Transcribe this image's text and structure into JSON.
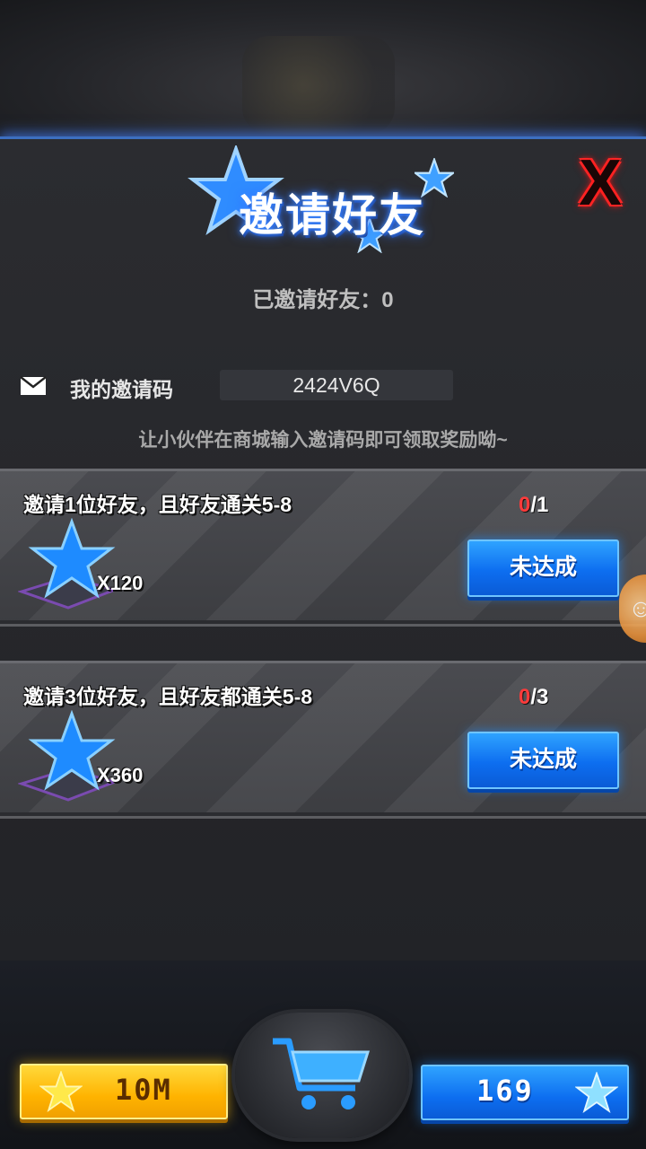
{
  "header": {
    "title": "邀请好友",
    "close_label": "X"
  },
  "invite": {
    "invited_text": "已邀请好友：0",
    "code_label": "我的邀请码",
    "code_value": "2424V6Q",
    "hint": "让小伙伴在商城输入邀请码即可领取奖励呦~"
  },
  "tasks": [
    {
      "title": "邀请1位好友，且好友通关5-8",
      "progress_current": "0",
      "progress_total": "/1",
      "reward_qty": "X120",
      "button_label": "未达成"
    },
    {
      "title": "邀请3位好友，且好友都通关5-8",
      "progress_current": "0",
      "progress_total": "/3",
      "reward_qty": "X360",
      "button_label": "未达成"
    }
  ],
  "resources": {
    "gold_value": "10M",
    "star_value": "169"
  },
  "icons": {
    "mail": "mail-icon",
    "reward": "blue-star-icon",
    "gold": "gold-star-icon",
    "star": "blue-star-icon",
    "shop": "cart-icon",
    "side": "side-menu-icon"
  },
  "colors": {
    "accent_blue": "#0d6ef0",
    "gold": "#ffb300",
    "progress_red": "#ff3b3b",
    "close_red": "#ff2020"
  }
}
